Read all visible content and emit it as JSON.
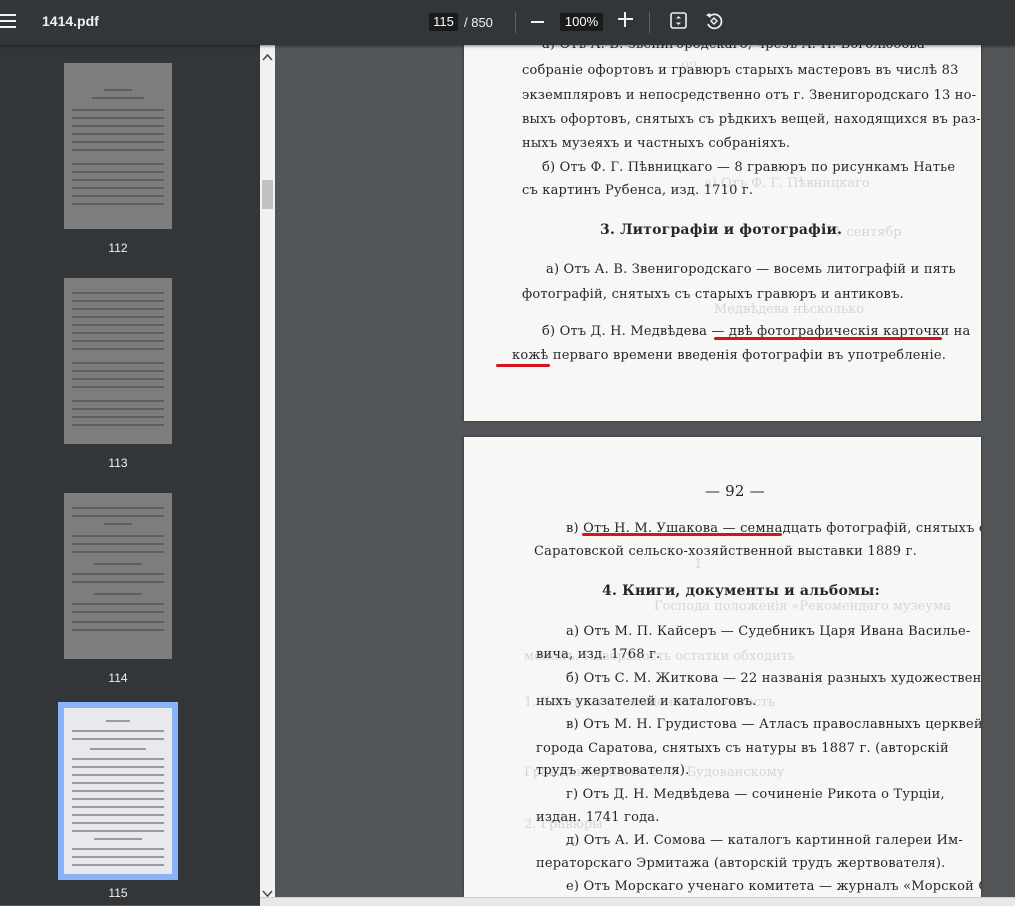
{
  "toolbar": {
    "title": "1414.pdf",
    "page_current": "115",
    "page_total": "/ 850",
    "zoom": "100%"
  },
  "thumbnails": [
    {
      "label": "112"
    },
    {
      "label": "113"
    },
    {
      "label": "114"
    },
    {
      "label": "115",
      "selected": true
    }
  ],
  "page_114": {
    "lines": [
      "а) Отъ А. В. Звенигородскаго, чрезъ А. Н. Боголюбова —",
      "собраніе офортовъ и гравюръ старыхъ мастеровъ въ числѣ 83",
      "экземпляровъ и непосредственно отъ г. Звенигородскаго 13 но-",
      "выхъ офортовъ, снятыхъ съ рѣдкихъ вещей, находящихся въ раз-",
      "ныхъ музеяхъ и частныхъ собраніяхъ.",
      "б) Отъ Ф. Г. Пѣвницкаго — 8 гравюръ по рисункамъ Натье",
      "съ картинъ Рубенса, изд. 1710 г."
    ],
    "heading": "3. Литографіи и фотографіи.",
    "lines2": [
      "а) Отъ А. В. Звенигородскаго — восемь литографій и пять",
      "фотографій, снятыхъ съ старыхъ гравюръ и антиковъ.",
      "б) Отъ Д. Н. Медвѣдева — двѣ фотографическія карточки на",
      "кожѣ перваго времени введенія фотографіи въ употребленіе."
    ]
  },
  "page_115": {
    "page_number": "— 92 —",
    "lines": [
      "в) Отъ Н. М. Ушакова — семнадцать фотографій, снятыхъ съ",
      "Саратовской сельско-хозяйственной выставки 1889 г."
    ],
    "heading": "4. Книги, документы и альбомы:",
    "lines2": [
      "а) Отъ М. П. Кайсеръ — Судебникъ Царя Ивана Василье-",
      "вича, изд. 1768 г.",
      "б) Отъ С. М. Житкова — 22 названія разныхъ художествен-",
      "ныхъ указателей и каталоговъ.",
      "в) Отъ М. Н. Грудистова — Атласъ православныхъ церквей",
      "города Саратова, снятыхъ съ натуры въ 1887 г. (авторскій",
      "трудъ жертвователя).",
      "г) Отъ Д. Н. Медвѣдева — сочиненіе Рикота о Турціи,",
      "издан. 1741 года.",
      "д) Отъ А. И. Сомова — каталогъ картинной галереи Им-",
      "ператорскаго Эрмитажа (авторскій трудъ жертвователя).",
      "е) Отъ Морскаго ученаго комитета — журналъ «Морской Сбор-"
    ]
  },
  "colors": {
    "toolbar_bg": "#323639",
    "viewer_bg": "#525659",
    "selection": "#8ab4f8",
    "annotation": "#d5141c"
  },
  "icons": [
    "menu-icon",
    "zoom-out-icon",
    "zoom-in-icon",
    "fit-page-icon",
    "rotate-icon",
    "chevron-up-icon",
    "chevron-down-icon"
  ]
}
